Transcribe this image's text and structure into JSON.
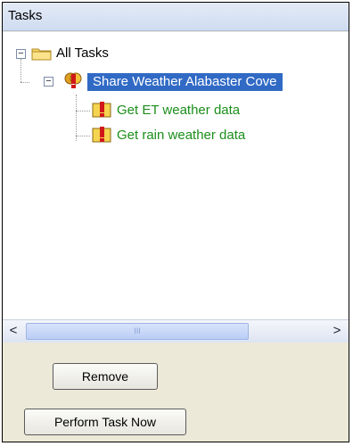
{
  "panel": {
    "title": "Tasks"
  },
  "tree": {
    "root": {
      "label": "All Tasks"
    },
    "group": {
      "label": "Share Weather Alabaster Cove"
    },
    "children": [
      {
        "label": "Get ET weather data"
      },
      {
        "label": "Get rain weather data"
      }
    ]
  },
  "scrollbar": {
    "left_arrow": "<",
    "right_arrow": ">",
    "grip": "III"
  },
  "buttons": {
    "remove_label": "Remove",
    "perform_label": "Perform Task Now"
  },
  "colors": {
    "selection": "#316ac5",
    "child_text": "#1b8f1b"
  }
}
